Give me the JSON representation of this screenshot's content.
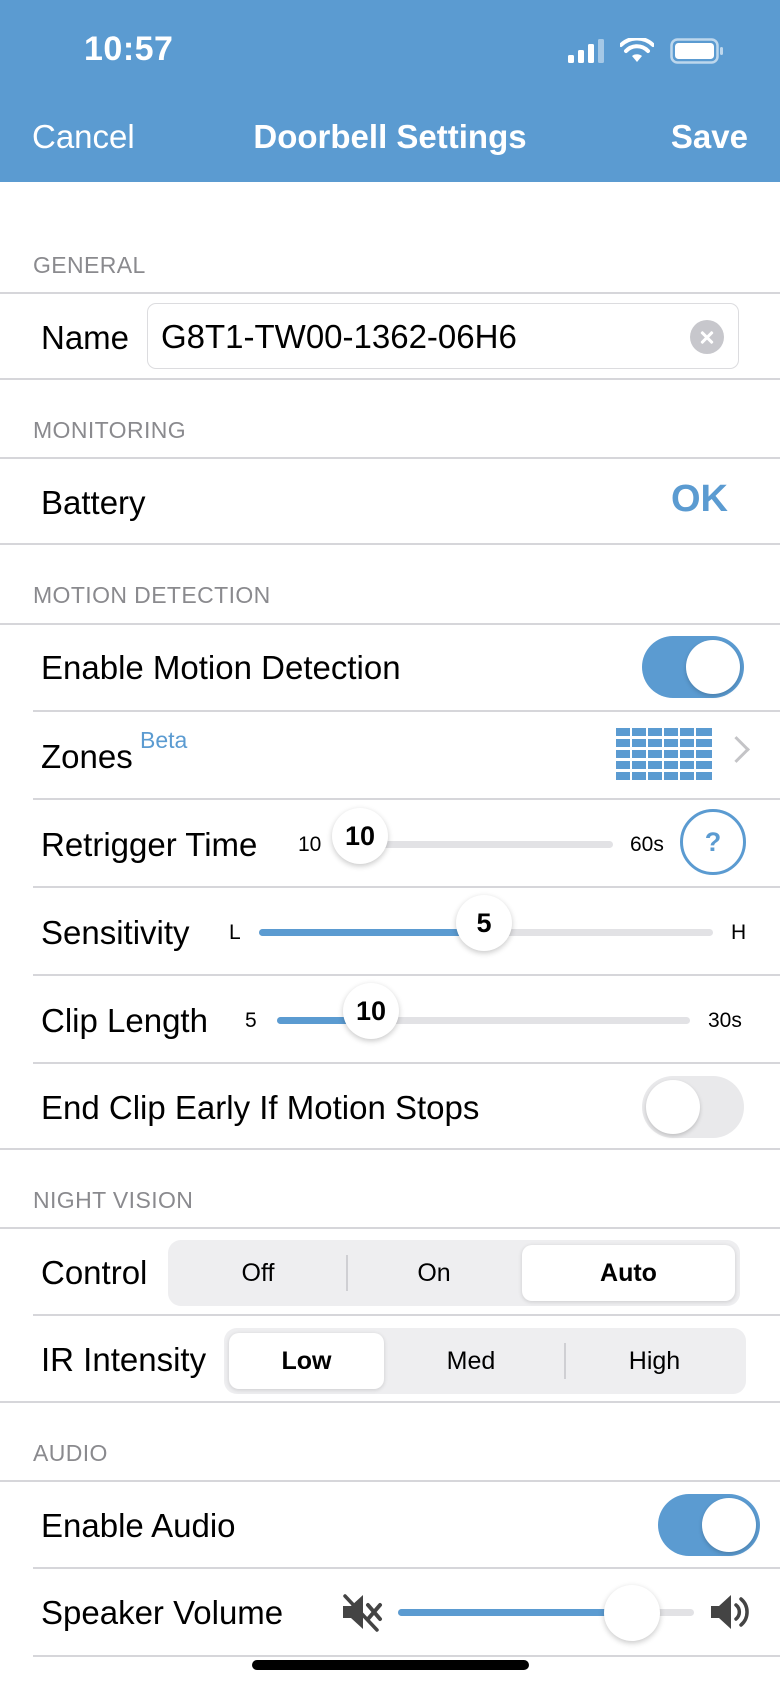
{
  "status_bar": {
    "time": "10:57"
  },
  "nav": {
    "cancel": "Cancel",
    "title": "Doorbell Settings",
    "save": "Save"
  },
  "general": {
    "header": "GENERAL",
    "name_label": "Name",
    "name_value": "G8T1-TW00-1362-06H6"
  },
  "monitoring": {
    "header": "MONITORING",
    "battery_label": "Battery",
    "battery_status": "OK"
  },
  "motion": {
    "header": "MOTION DETECTION",
    "enable_label": "Enable Motion Detection",
    "enable_on": true,
    "zones_label": "Zones",
    "zones_badge": "Beta",
    "retrigger_label": "Retrigger Time",
    "retrigger_min": "10",
    "retrigger_max": "60s",
    "retrigger_value": "10",
    "retrigger_help": "?",
    "sensitivity_label": "Sensitivity",
    "sensitivity_min": "L",
    "sensitivity_max": "H",
    "sensitivity_value": "5",
    "clip_label": "Clip Length",
    "clip_min": "5",
    "clip_max": "30s",
    "clip_value": "10",
    "end_clip_label": "End Clip Early If Motion Stops",
    "end_clip_on": false
  },
  "night_vision": {
    "header": "NIGHT VISION",
    "control_label": "Control",
    "control_options": [
      "Off",
      "On",
      "Auto"
    ],
    "control_selected": "Auto",
    "ir_label": "IR Intensity",
    "ir_options": [
      "Low",
      "Med",
      "High"
    ],
    "ir_selected": "Low"
  },
  "audio": {
    "header": "AUDIO",
    "enable_label": "Enable Audio",
    "enable_on": true,
    "speaker_label": "Speaker Volume",
    "speaker_level": 0.79
  },
  "colors": {
    "accent": "#5b9bd1",
    "separator": "#d6d6da"
  },
  "icons": {
    "signal": "signal-bars-icon",
    "wifi": "wifi-icon",
    "battery": "battery-icon",
    "zones": "grid-icon",
    "chevron": "chevron-right-icon",
    "mute": "speaker-mute-icon",
    "volume": "speaker-volume-icon"
  }
}
